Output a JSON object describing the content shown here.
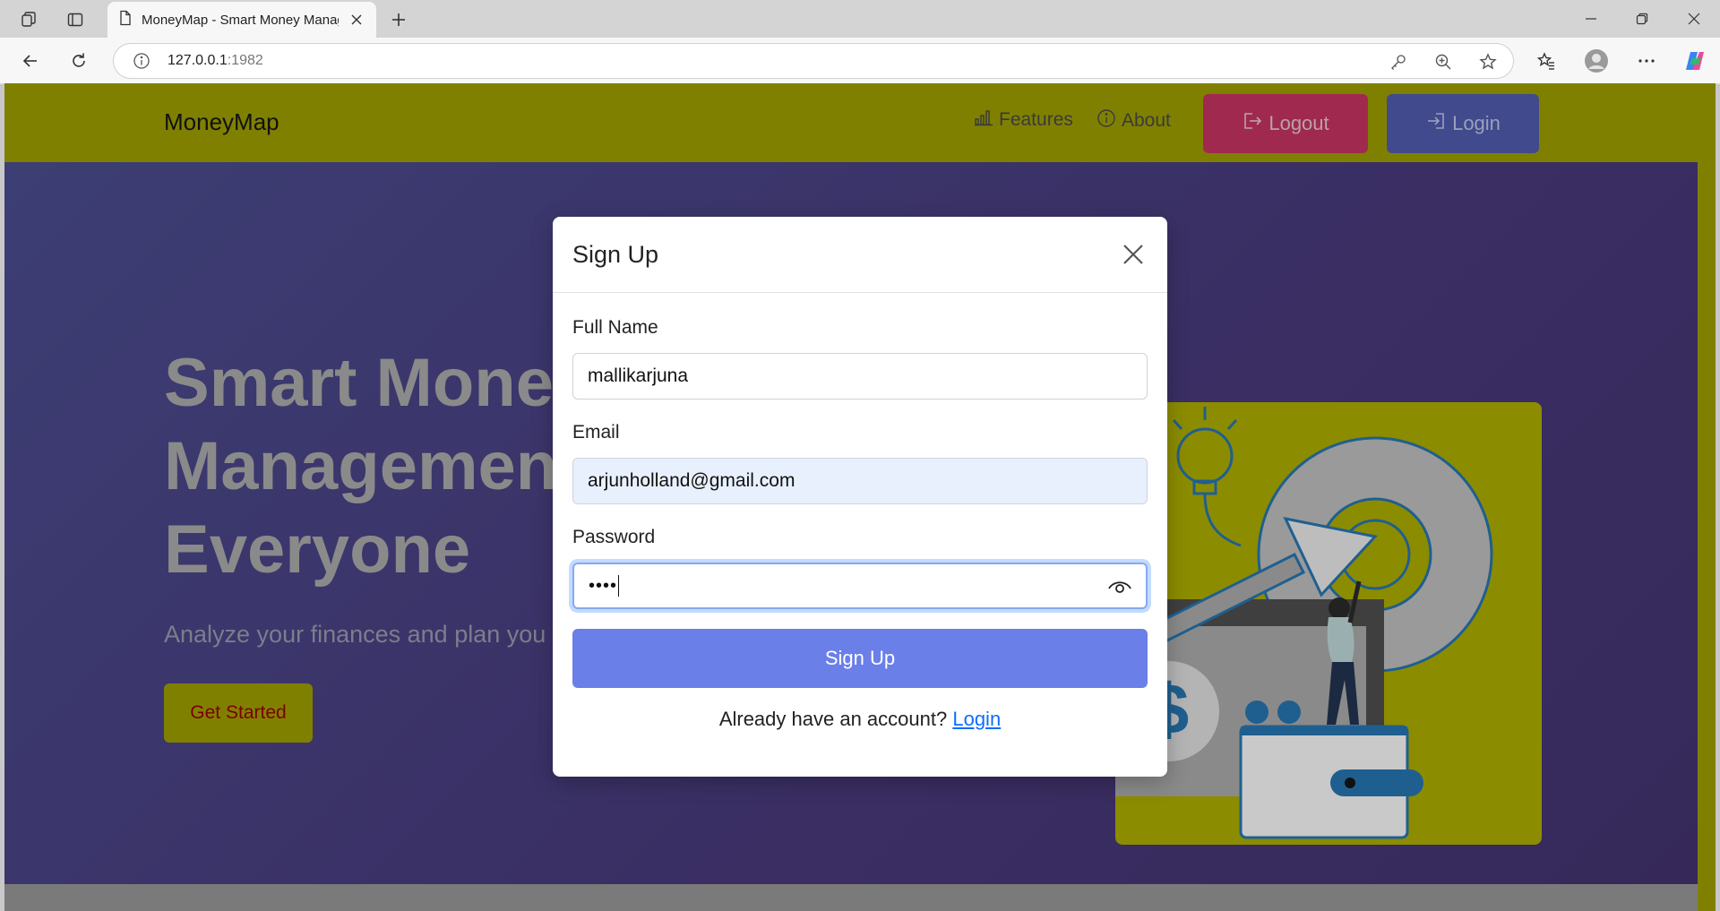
{
  "browser": {
    "tab_title": "MoneyMap - Smart Money Management",
    "url_host": "127.0.0.1",
    "url_port": ":1982"
  },
  "nav": {
    "brand": "MoneyMap",
    "links": [
      "Features",
      "About"
    ],
    "logout_label": "Logout",
    "login_label": "Login"
  },
  "hero": {
    "title_line1": "Smart Mone",
    "title_line2": "Managemen",
    "title_line3": "Everyone",
    "subtitle": "Analyze your finances and plan you",
    "cta_label": "Get Started"
  },
  "modal": {
    "title": "Sign Up",
    "fullname_label": "Full Name",
    "fullname_value": "mallikarjuna",
    "email_label": "Email",
    "email_value": "arjunholland@gmail.com",
    "password_label": "Password",
    "password_mask": "••••",
    "submit_label": "Sign Up",
    "footer_text": "Already have an account?",
    "footer_link": "Login"
  },
  "colors": {
    "navbar": "#808000",
    "logout": "#a0294f",
    "login": "#404a8c",
    "submit": "#6a7fe8",
    "link": "#0d6efd"
  }
}
